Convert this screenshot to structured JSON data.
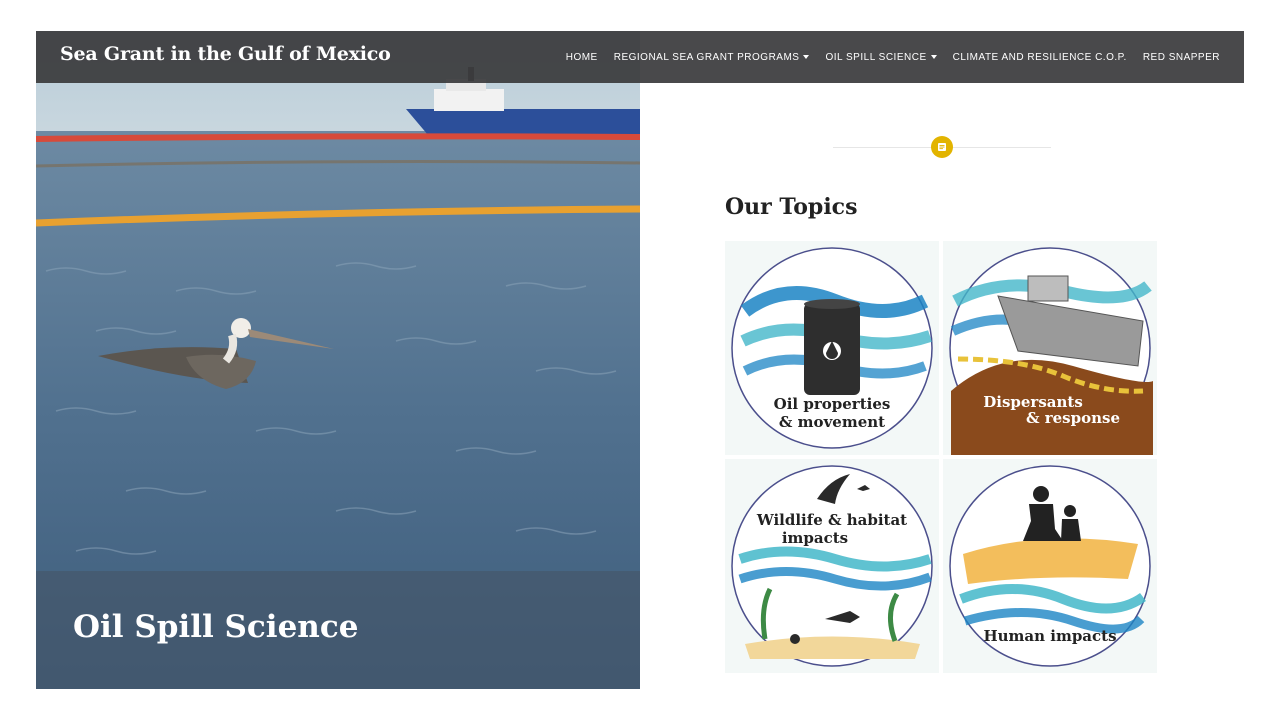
{
  "site": {
    "brand": "Sea Grant in the Gulf of Mexico"
  },
  "nav": {
    "items": [
      {
        "label": "HOME",
        "dropdown": false
      },
      {
        "label": "REGIONAL SEA GRANT PROGRAMS",
        "dropdown": true
      },
      {
        "label": "OIL SPILL SCIENCE",
        "dropdown": true
      },
      {
        "label": "CLIMATE AND RESILIENCE C.O.P.",
        "dropdown": false
      },
      {
        "label": "RED SNAPPER",
        "dropdown": false
      }
    ]
  },
  "hero": {
    "title": "Oil Spill Science"
  },
  "topics": {
    "heading": "Our Topics",
    "badge_icon": "document-icon",
    "items": [
      {
        "line1": "Oil properties",
        "line2": "& movement",
        "icon": "oil-barrel-icon"
      },
      {
        "line1": "Dispersants",
        "line2": "& response",
        "icon": "boat-boom-icon"
      },
      {
        "line1": "Wildlife & habitat",
        "line2": "impacts",
        "icon": "bird-fish-icon"
      },
      {
        "line1": "Human impacts",
        "line2": "",
        "icon": "people-beach-icon"
      }
    ]
  },
  "colors": {
    "navbar": "#3a3a3c",
    "accent": "#e2b400",
    "water": "#4a6a8a"
  }
}
